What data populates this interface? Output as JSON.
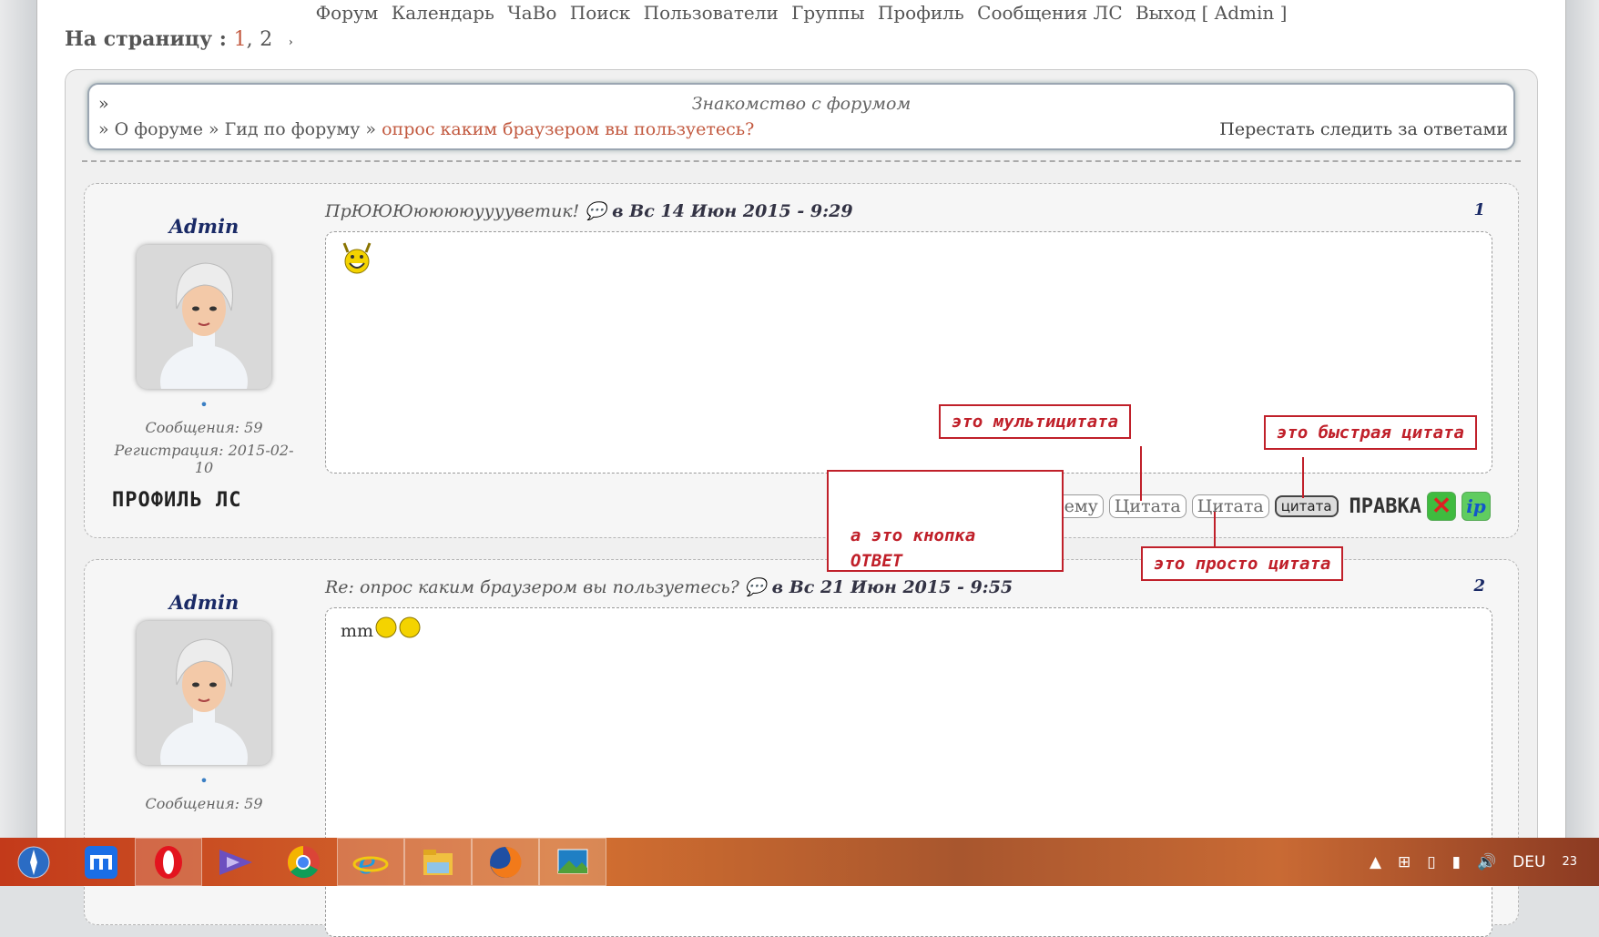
{
  "topnav": {
    "forum": "Форум",
    "calendar": "Календарь",
    "faq": "ЧаВо",
    "search": "Поиск",
    "users": "Пользователи",
    "groups": "Группы",
    "profile": "Профиль",
    "messages": "Сообщения ЛС",
    "logout": "Выход [ Admin ]"
  },
  "pagination": {
    "label": "На страницу :",
    "current": "1",
    "sep": ",",
    "page2": "2",
    "arrow": "›"
  },
  "breadcrumb": {
    "lead": "»",
    "section_title": "Знакомство с форумом",
    "path": "» О форуме » Гид по форуму »",
    "current": "опрос каким браузером вы пользуетесь?",
    "unwatch": "Перестать следить за ответами"
  },
  "posts": [
    {
      "author": "Admin",
      "dot": "•",
      "messages": "Сообщения: 59",
      "registered": "Регистрация: 2015-02-10",
      "profile_pm": "ПРОФИЛЬ ЛС",
      "title": "ПрЮЮЮююююууууветик!",
      "date": "в Вс 14 Июн 2015 - 9:29",
      "number": "1",
      "body": ""
    },
    {
      "author": "Admin",
      "dot": "•",
      "messages": "Сообщения: 59",
      "title": "Re: опрос каким браузером вы пользуетесь?",
      "date": "в Вс 21 Июн 2015 - 9:55",
      "number": "2",
      "body": "mm"
    }
  ],
  "buttons": {
    "reply": "Ответить на тему",
    "multiquote": "Цитата",
    "quote": "Цитата",
    "quick_quote": "цитата",
    "edit": "ПРАВКА",
    "delete": "✕",
    "ip": "ip"
  },
  "annotations": {
    "multiquote": "это мультицитата",
    "quick_quote": "это быстрая цитата",
    "reply_line1": "а это кнопка",
    "reply_line2": "ОТВЕТ",
    "quote": "это просто цитата"
  },
  "taskbar": {
    "apps": [
      "safari-icon",
      "maxthon-icon",
      "opera-icon",
      "visual-studio-icon",
      "chrome-icon",
      "internet-explorer-icon",
      "file-explorer-icon",
      "firefox-icon",
      "photos-icon"
    ],
    "lang": "DEU",
    "clock_fragment": "23"
  },
  "colors": {
    "link_current": "#c2593f",
    "author_name": "#1a2a66",
    "annotation": "#c0202a"
  }
}
